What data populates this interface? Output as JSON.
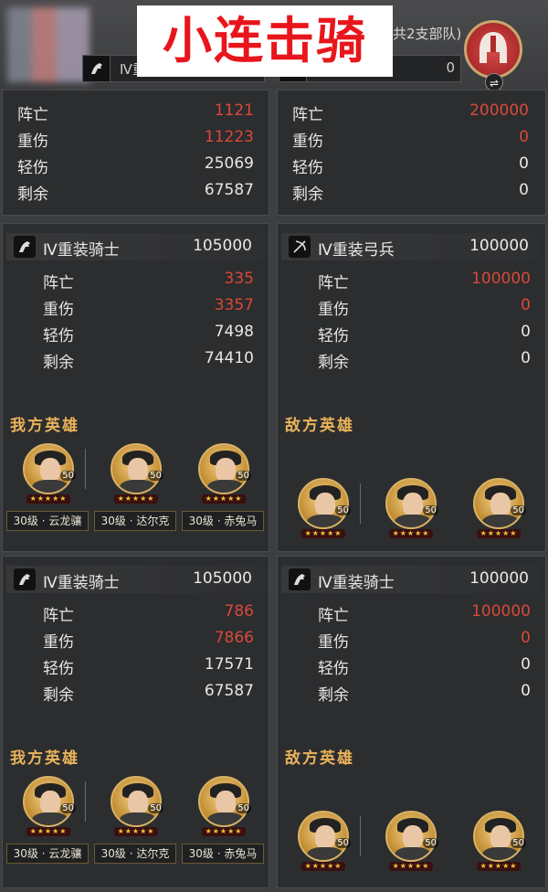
{
  "title_banner": "小连击骑",
  "top": {
    "right_count_label": "共2支部队)",
    "left_unit_name": "Ⅳ重装骑士",
    "right_unit_value": "0",
    "left_stats": [
      {
        "label": "阵亡",
        "value": "1121",
        "color": "red"
      },
      {
        "label": "重伤",
        "value": "11223",
        "color": "red"
      },
      {
        "label": "轻伤",
        "value": "25069",
        "color": "white"
      },
      {
        "label": "剩余",
        "value": "67587",
        "color": "white"
      }
    ],
    "right_stats": [
      {
        "label": "阵亡",
        "value": "200000",
        "color": "red"
      },
      {
        "label": "重伤",
        "value": "0",
        "color": "red"
      },
      {
        "label": "轻伤",
        "value": "0",
        "color": "white"
      },
      {
        "label": "剩余",
        "value": "0",
        "color": "white"
      }
    ],
    "emblem_swap": "⇌"
  },
  "battle1": {
    "left": {
      "unit_name": "Ⅳ重装骑士",
      "total": "105000",
      "stats": [
        {
          "label": "阵亡",
          "value": "335",
          "color": "red"
        },
        {
          "label": "重伤",
          "value": "3357",
          "color": "red"
        },
        {
          "label": "轻伤",
          "value": "7498",
          "color": "white"
        },
        {
          "label": "剩余",
          "value": "74410",
          "color": "white"
        }
      ],
      "heroes_title": "我方英雄",
      "heroes": [
        {
          "level": "50",
          "stars": "★★★★★",
          "tag": "30级 · 云龙骧"
        },
        {
          "level": "50",
          "stars": "★★★★★",
          "tag": "30级 · 达尔克"
        },
        {
          "level": "50",
          "stars": "★★★★★",
          "tag": "30级 · 赤兔马"
        }
      ]
    },
    "right": {
      "unit_name": "Ⅳ重装弓兵",
      "total": "100000",
      "stats": [
        {
          "label": "阵亡",
          "value": "100000",
          "color": "red"
        },
        {
          "label": "重伤",
          "value": "0",
          "color": "red"
        },
        {
          "label": "轻伤",
          "value": "0",
          "color": "white"
        },
        {
          "label": "剩余",
          "value": "0",
          "color": "white"
        }
      ],
      "heroes_title": "敌方英雄",
      "heroes": [
        {
          "level": "50",
          "stars": "★★★★★"
        },
        {
          "level": "50",
          "stars": "★★★★★"
        },
        {
          "level": "50",
          "stars": "★★★★★"
        }
      ]
    }
  },
  "battle2": {
    "left": {
      "unit_name": "Ⅳ重装骑士",
      "total": "105000",
      "stats": [
        {
          "label": "阵亡",
          "value": "786",
          "color": "red"
        },
        {
          "label": "重伤",
          "value": "7866",
          "color": "red"
        },
        {
          "label": "轻伤",
          "value": "17571",
          "color": "white"
        },
        {
          "label": "剩余",
          "value": "67587",
          "color": "white"
        }
      ],
      "heroes_title": "我方英雄",
      "heroes": [
        {
          "level": "50",
          "stars": "★★★★★",
          "tag": "30级 · 云龙骧"
        },
        {
          "level": "50",
          "stars": "★★★★★",
          "tag": "30级 · 达尔克"
        },
        {
          "level": "50",
          "stars": "★★★★★",
          "tag": "30级 · 赤兔马"
        }
      ]
    },
    "right": {
      "unit_name": "Ⅳ重装骑士",
      "total": "100000",
      "stats": [
        {
          "label": "阵亡",
          "value": "100000",
          "color": "red"
        },
        {
          "label": "重伤",
          "value": "0",
          "color": "red"
        },
        {
          "label": "轻伤",
          "value": "0",
          "color": "white"
        },
        {
          "label": "剩余",
          "value": "0",
          "color": "white"
        }
      ],
      "heroes_title": "敌方英雄",
      "heroes": [
        {
          "level": "50",
          "stars": "★★★★★"
        },
        {
          "level": "50",
          "stars": "★★★★★"
        },
        {
          "level": "50",
          "stars": "★★★★★"
        }
      ]
    }
  },
  "colors": {
    "red": "#d9483b",
    "white": "#e9e7e2",
    "gold": "#e9b35b"
  }
}
